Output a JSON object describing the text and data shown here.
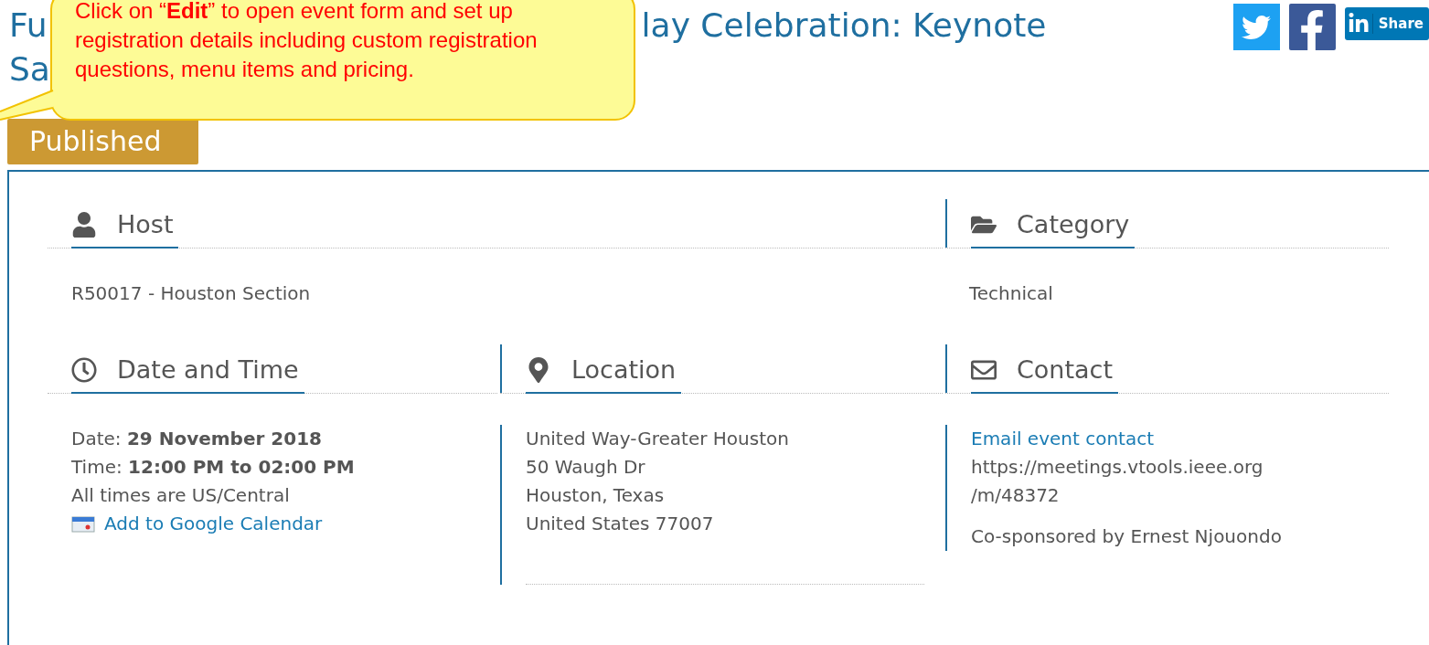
{
  "title": {
    "line_1_start": "Fu",
    "line_1_end": "lay Celebration: Keynote",
    "line_2": "Sa"
  },
  "share": [
    {
      "kind": "twitter"
    },
    {
      "kind": "facebook"
    },
    {
      "kind": "linkedin",
      "label": "Share"
    }
  ],
  "status": "Published",
  "callout": "Click on “**Edit**”  to open event form and set up registration details including custom registration questions, menu items and pricing.",
  "sections": [
    [
      {
        "heading": "Host",
        "lines": [
          {
            "kind": "text",
            "text": "R50017 - Houston Section"
          }
        ]
      },
      {
        "heading": "Category",
        "lines": [
          {
            "kind": "text",
            "text": "Technical"
          }
        ]
      }
    ],
    [
      {
        "heading": "Date and Time",
        "lines": [
          {
            "kind": "text",
            "text": "Date: **29 November 2018**"
          },
          {
            "kind": "text",
            "text": "Time: **12:00 PM to 02:00 PM**"
          },
          {
            "kind": "text",
            "text": "All times are US/Central"
          },
          {
            "kind": "calendar-link",
            "text": "Add to Google Calendar"
          }
        ]
      },
      {
        "heading": "Location",
        "lines": [
          {
            "kind": "text",
            "text": "United Way-Greater Houston"
          },
          {
            "kind": "text",
            "text": "50 Waugh Dr"
          },
          {
            "kind": "text",
            "text": "Houston, Texas"
          },
          {
            "kind": "text",
            "text": "United States 77007"
          }
        ]
      },
      {
        "heading": "Contact",
        "lines": [
          {
            "kind": "link",
            "text": "Email event contact"
          },
          {
            "kind": "text",
            "text": "https://meetings.vtools.ieee.org"
          },
          {
            "kind": "text",
            "text": "/m/48372"
          },
          {
            "kind": "note",
            "text": "Co-sponsored by Ernest Njouondo"
          }
        ]
      }
    ]
  ]
}
